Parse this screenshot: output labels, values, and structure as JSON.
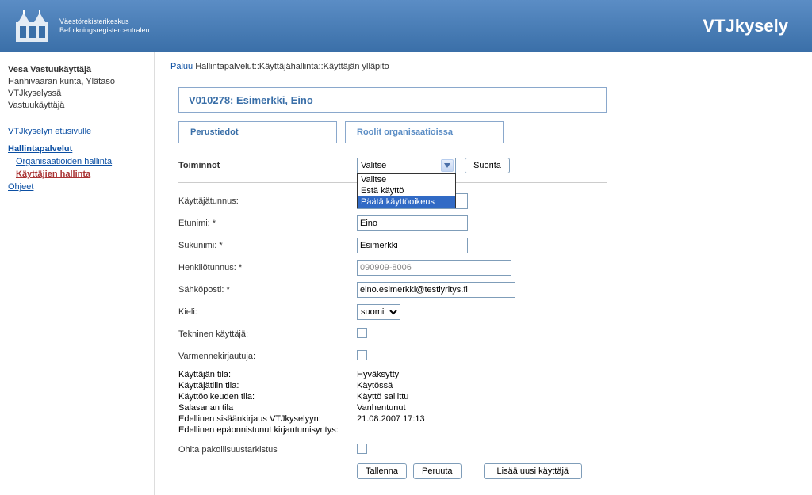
{
  "header": {
    "org_line1": "Väestörekisterikeskus",
    "org_line2": "Befolkningsregistercentralen",
    "app_title": "VTJkysely"
  },
  "sidebar": {
    "user_name": "Vesa Vastuukäyttäjä",
    "user_org": "Hanhivaaran kunta, Ylätaso",
    "user_context": "VTJkyselyssä",
    "user_role": "Vastuukäyttäjä",
    "frontpage": "VTJkyselyn etusivulle",
    "admin_title": "Hallintapalvelut",
    "admin_orgs": "Organisaatioiden hallinta",
    "admin_users": "Käyttäjien hallinta",
    "help": "Ohjeet"
  },
  "breadcrumb": {
    "back": "Paluu",
    "trail": "Hallintapalvelut::Käyttäjähallinta::Käyttäjän ylläpito"
  },
  "page": {
    "title": "V010278: Esimerkki, Eino",
    "tab_basic": "Perustiedot",
    "tab_roles": "Roolit organisaatioissa"
  },
  "toiminnot": {
    "label": "Toiminnot",
    "selected": "Valitse",
    "options": [
      "Valitse",
      "Estä käyttö",
      "Päätä käyttöoikeus"
    ],
    "button": "Suorita"
  },
  "form": {
    "username_label": "Käyttäjätunnus:",
    "username_value": "",
    "firstname_label": "Etunimi: *",
    "firstname_value": "Eino",
    "lastname_label": "Sukunimi: *",
    "lastname_value": "Esimerkki",
    "hetu_label": "Henkilötunnus: *",
    "hetu_value": "090909-8006",
    "email_label": "Sähköposti: *",
    "email_value": "eino.esimerkki@testiyritys.fi",
    "lang_label": "Kieli:",
    "lang_value": "suomi",
    "technical_label": "Tekninen käyttäjä:",
    "cert_label": "Varmennekirjautuja:"
  },
  "status": {
    "user_state_label": "Käyttäjän tila:",
    "user_state_value": "Hyväksytty",
    "account_state_label": "Käyttäjätilin tila:",
    "account_state_value": "Käytössä",
    "right_state_label": "Käyttöoikeuden tila:",
    "right_state_value": "Käyttö sallittu",
    "password_state_label": "Salasanan tila",
    "password_state_value": "Vanhentunut",
    "last_login_label": "Edellinen sisäänkirjaus VTJkyselyyn:",
    "last_login_value": "21.08.2007 17:13",
    "last_fail_label": "Edellinen epäonnistunut kirjautumisyritys:",
    "last_fail_value": ""
  },
  "skip": {
    "label": "Ohita pakollisuustarkistus"
  },
  "buttons": {
    "save": "Tallenna",
    "cancel": "Peruuta",
    "add_new": "Lisää uusi käyttäjä"
  }
}
